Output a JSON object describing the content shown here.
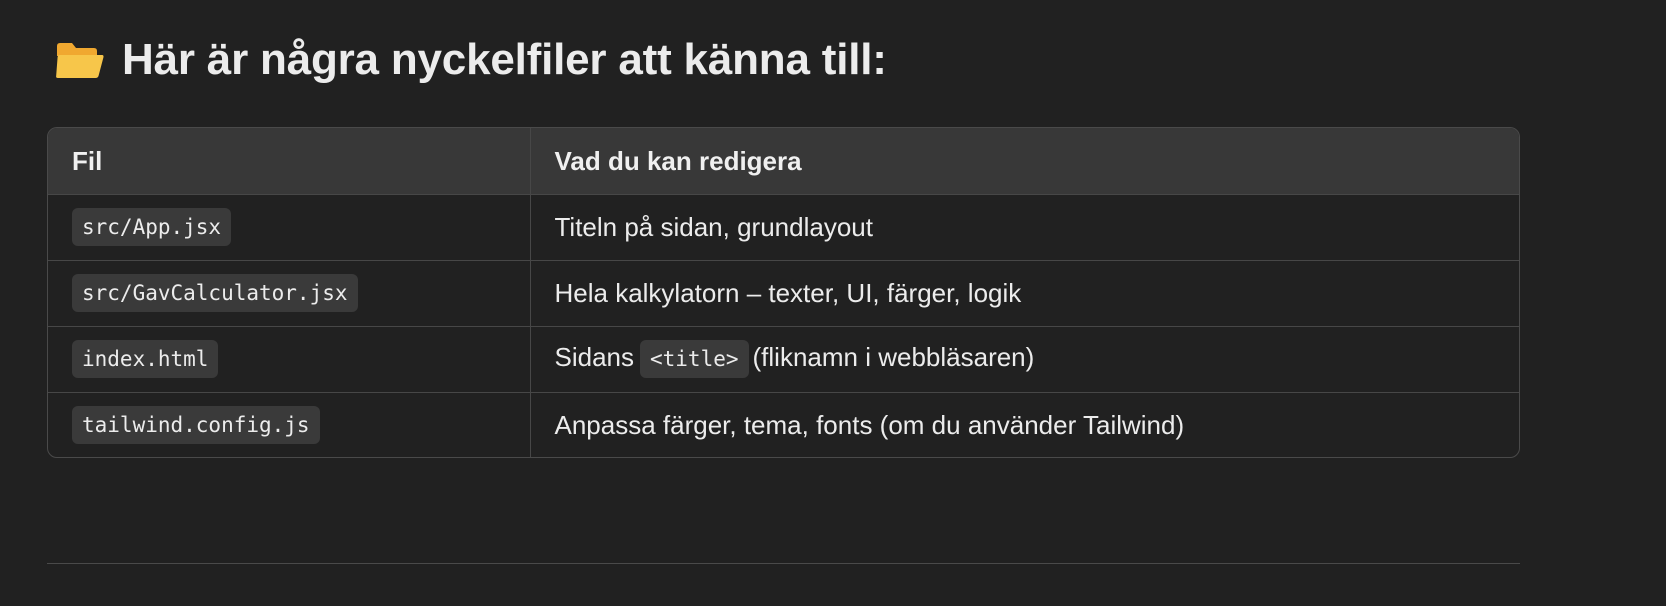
{
  "heading": {
    "icon": "open-folder-icon",
    "text": "Här är några nyckelfiler att känna till:"
  },
  "colors": {
    "background": "#212121",
    "header_row": "#383838",
    "code_bg": "#3a3a3a",
    "folder_yellow": "#F7C64A",
    "folder_back": "#F0A830"
  },
  "table": {
    "columns": [
      "Fil",
      "Vad du kan redigera"
    ],
    "rows": [
      {
        "file": "src/App.jsx",
        "description": "Titeln på sidan, grundlayout"
      },
      {
        "file": "src/GavCalculator.jsx",
        "description": "Hela kalkylatorn – texter, UI, färger, logik"
      },
      {
        "file": "index.html",
        "description_before": "Sidans",
        "description_code": "<title>",
        "description_after": "(fliknamn i webbläsaren)"
      },
      {
        "file": "tailwind.config.js",
        "description": "Anpassa färger, tema, fonts (om du använder Tailwind)"
      }
    ]
  }
}
